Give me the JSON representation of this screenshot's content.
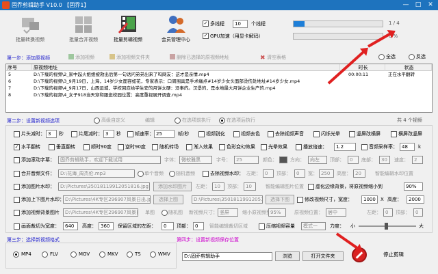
{
  "window": {
    "title": "固乔剪辑助手 V10.0 【固乔1】",
    "min": "—",
    "max": "□",
    "close": "✕"
  },
  "toolbar": [
    {
      "label": "批量转换视频",
      "enabled": false,
      "icon": "video-convert-icon"
    },
    {
      "label": "批量合并视频",
      "enabled": false,
      "icon": "video-merge-icon"
    },
    {
      "label": "批量剪辑视频",
      "enabled": true,
      "icon": "film-edit-icon"
    },
    {
      "label": "会员管理中心",
      "enabled": true,
      "icon": "member-center-icon"
    }
  ],
  "threads": {
    "multi_label": "多线程",
    "count": "10",
    "unit": "个线程",
    "gpu_label": "GPU加速（用显卡解码）",
    "counter": "1 / 4",
    "percent": "0 %",
    "progress": 0.12
  },
  "step1": {
    "title": "第一步：添加原视频",
    "add_video": "添加视频",
    "add_folder": "添加视频文件夹",
    "delete": "删除已选择的原视频地址",
    "clear": "清空表格",
    "select_all": "全选",
    "invert": "反选"
  },
  "table": {
    "headers": [
      "序号",
      "原视频地址",
      "时长",
      "状态"
    ],
    "rows": [
      {
        "no": "5",
        "path": "D:\\下载的视频\\2_家中起火姐姐被救出后第一句话问弟弟出来了吗网友：这才是亲情.mp4",
        "duration": "00:00:11",
        "status": "正在水平翻转"
      },
      {
        "no": "6",
        "path": "D:\\下载的视频\\3_9月19日，上海，14岁少女面容如花，专家表示：口周围具是手术痛点#14岁少女头面部烫伤处地址#14岁少女.mp4",
        "duration": "",
        "status": ""
      },
      {
        "no": "7",
        "path": "D:\\下载的视频\\4_9月17日，山西运城，学校回应给学生安的月饼太硬：没事的。汉堡的，是本地最大月饼企业生产的.mp4",
        "duration": "",
        "status": ""
      },
      {
        "no": "8",
        "path": "D:\\下载的视频\\4_女子918当天穿和服逛校园位置：高度重视展开调查.mp4",
        "duration": "",
        "status": ""
      }
    ]
  },
  "step2": {
    "title": "第二步：设置新视频选项",
    "adv": "高级自定义",
    "edit": "编辑",
    "selected_exec": "在选项前执行",
    "selected_exec2": "在选项后执行",
    "total": "共 4 个视频"
  },
  "opts": {
    "r1": [
      "片头减时：",
      "3",
      "秒",
      "片尾减时：",
      "3",
      "秒",
      "帧速率：",
      "25",
      "帧/秒",
      "视频锐化",
      "视频去色",
      "去除视频声音",
      "闪烁光晕",
      "竖屏改横屏",
      "横屏改竖屏"
    ],
    "r2": [
      "水平翻转",
      "垂直翻转",
      "顺时90度",
      "逆时90度",
      "随机转场",
      "渐入效果",
      "色彩变幻效果",
      "光晕效果",
      "播放倍速：",
      "1.2",
      "音频采样率：",
      "48",
      "k"
    ],
    "r3": [
      "添加滚动字幕：",
      "固乔剪辑助手，欢迎下载试用",
      "字体：",
      "微软雅黑",
      "字号：",
      "25",
      "颜色：",
      "方向：",
      "向左",
      "顶部：",
      "0",
      "底部：",
      "30",
      "速度：",
      "2"
    ],
    "r4": [
      "合并音频文件：",
      "D:\\花海_周杰伦.mp3",
      "单个音频",
      "随机音频",
      "去除视频水印：",
      "左距：",
      "0",
      "顶部：",
      "0",
      "宽：",
      "250",
      "高度：",
      "20",
      "智能编辑水印位置"
    ],
    "r5": [
      "添加图片水印：",
      "D:\\Pictures\\35018119912051816.jpg",
      "添加水印图片",
      "左距：",
      "10",
      "顶部：",
      "10",
      "智能编辑图片位置",
      "虚化边缘背景，将原视频缩小到",
      "90%"
    ],
    "r6": [
      "添加上下图片水印：",
      "D:\\Pictures\\4K专区296907风景日出.jpg",
      "选择上图",
      "D:\\Pictures\\35018119912051816.jpg",
      "选择下图",
      "修改视频尺寸，宽度：",
      "1000",
      "X",
      "高度：",
      "2000"
    ],
    "r7": [
      "添加视频背景图片",
      "D:\\Pictures\\4K专区296907风景日出.jpg",
      "单图",
      "随机图",
      "新视频尺寸：",
      "竖屏",
      "缩小原视频到",
      "95%",
      "原视频位置：",
      "居中",
      "左距：",
      "0",
      "顶部：",
      "0"
    ],
    "r8": [
      "画面裁切为宽度：",
      "640",
      "高度：",
      "360",
      "保留区域的左距：",
      "0",
      "顶部：",
      "0",
      "智能编辑裁切区域",
      "压缩视频容量",
      "模式一",
      "力度：",
      "小",
      "大"
    ]
  },
  "step3": {
    "title": "第三步：选择新视频格式",
    "formats": [
      "MP4",
      "FLV",
      "MOV",
      "MKV",
      "TS",
      "WMV"
    ],
    "selected": "MP4"
  },
  "step4": {
    "title": "第四步：设置新视频保存位置",
    "path": "D:\\固乔剪辑助手",
    "browse": "浏览",
    "open": "打开文件夹",
    "stop": "停止剪辑"
  },
  "colors": {
    "title_blue": "#1e73be",
    "step_blue": "#2222cc",
    "step_magenta": "#cc00cc",
    "arrow_red": "#e02020",
    "progress_blue": "#1e7fd8"
  }
}
